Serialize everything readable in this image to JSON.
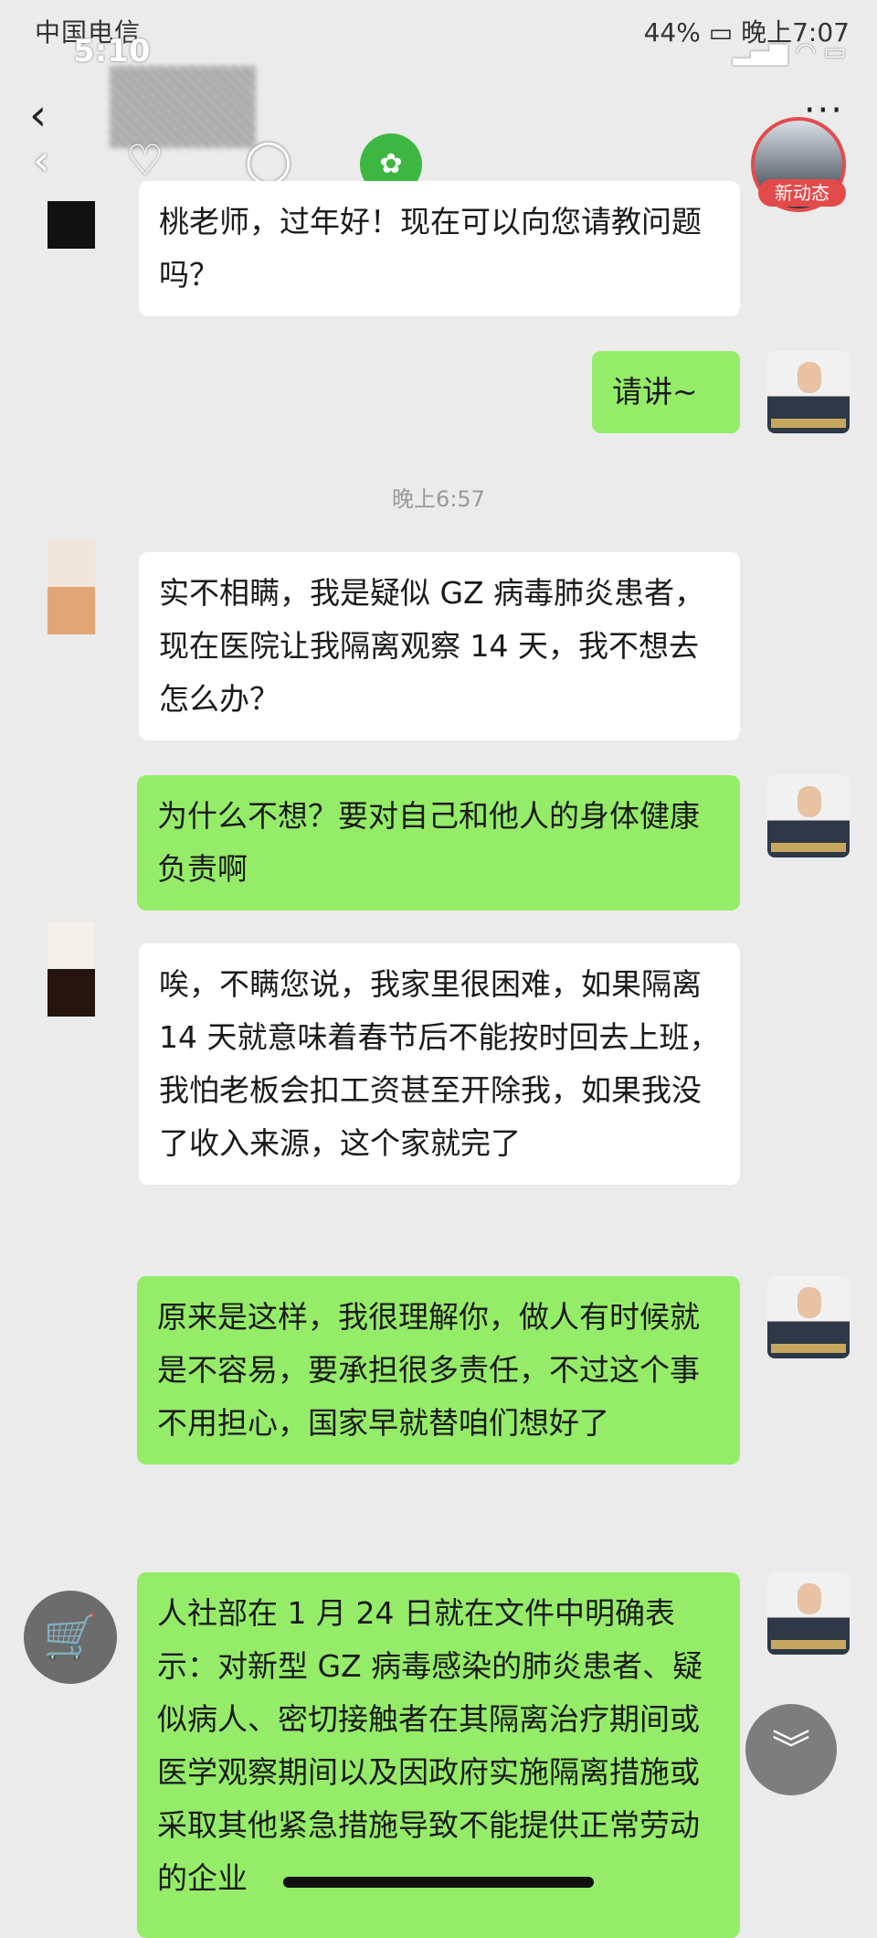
{
  "status_bar": {
    "carrier": "中国电信",
    "clock_overlay": "5:10",
    "battery": "44%",
    "time": "晚上7:07"
  },
  "feed_badge": "新动态",
  "messages": [
    {
      "side": "in",
      "text": "桃老师，过年好！现在可以向您请教问题吗？"
    },
    {
      "side": "out",
      "text": "请讲~"
    },
    {
      "side": "time",
      "text": "晚上6:57"
    },
    {
      "side": "in",
      "text": "实不相瞒，我是疑似 GZ 病毒肺炎患者，现在医院让我隔离观察 14 天，我不想去怎么办？"
    },
    {
      "side": "out",
      "text": "为什么不想？要对自己和他人的身体健康负责啊"
    },
    {
      "side": "in",
      "text": "唉，不瞒您说，我家里很困难，如果隔离 14 天就意味着春节后不能按时回去上班，我怕老板会扣工资甚至开除我，如果我没了收入来源，这个家就完了"
    },
    {
      "side": "out",
      "text": "原来是这样，我很理解你，做人有时候就是不容易，要承担很多责任，不过这个事不用担心，国家早就替咱们想好了"
    },
    {
      "side": "out",
      "text": "人社部在 1 月 24 日就在文件中明确表示：对新型 GZ 病毒感染的肺炎患者、疑似病人、密切接触者在其隔离治疗期间或医学观察期间以及因政府实施隔离措施或采取其他紧急措施导致不能提供正常劳动的企业"
    }
  ],
  "icons": {
    "back": "chevron-left-icon",
    "like": "heart-icon",
    "comment": "comment-icon",
    "wechat": "wechat-icon",
    "more": "more-dots-icon",
    "cart": "cart-icon",
    "scroll_down": "double-chevron-down-icon"
  },
  "colors": {
    "incoming_bubble": "#ffffff",
    "outgoing_bubble": "#95ec69",
    "background": "#ebebeb",
    "badge": "#e34b4b"
  }
}
